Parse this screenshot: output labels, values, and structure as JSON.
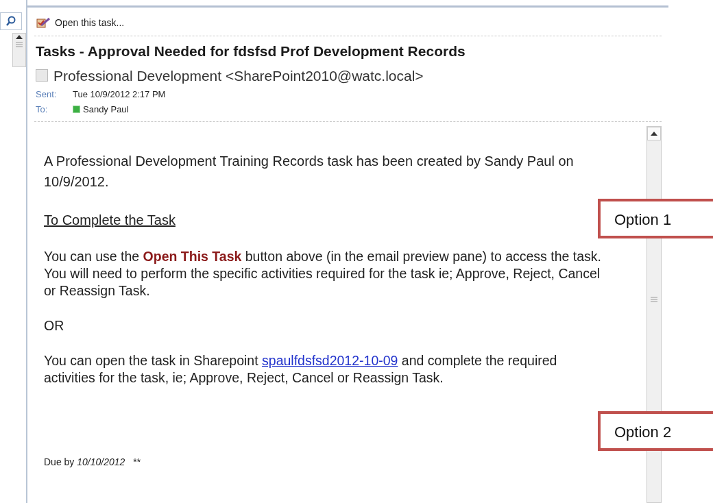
{
  "toolbar": {
    "open_task_label": "Open this task..."
  },
  "message": {
    "subject": "Tasks - Approval Needed for fdsfsd Prof Development Records",
    "sender": "Professional Development <SharePoint2010@watc.local>",
    "sent_label": "Sent:",
    "sent_value": "Tue 10/9/2012 2:17 PM",
    "to_label": "To:",
    "to_value": "Sandy Paul"
  },
  "body": {
    "intro": "A Professional Development Training Records task has been created by Sandy Paul on 10/9/2012.",
    "heading": "To Complete the Task",
    "option1": "You can use the **Open This Task** button above (in the email preview pane) to access the task.  You will need to perform the specific activities required for the task ie; Approve, Reject, Cancel or Reassign Task.",
    "or": "OR",
    "option2_before": "You can open the task in Sharepoint",
    "option2_link": "spaulfdsfsd2012-10-09",
    "option2_after": "and complete the required activities for the task, ie; Approve, Reject, Cancel or Reassign Task.",
    "due": "Due by *10/10/2012*",
    "due_mark": "**"
  },
  "callouts": [
    {
      "label": "Option 1"
    },
    {
      "label": "Option 2"
    }
  ]
}
